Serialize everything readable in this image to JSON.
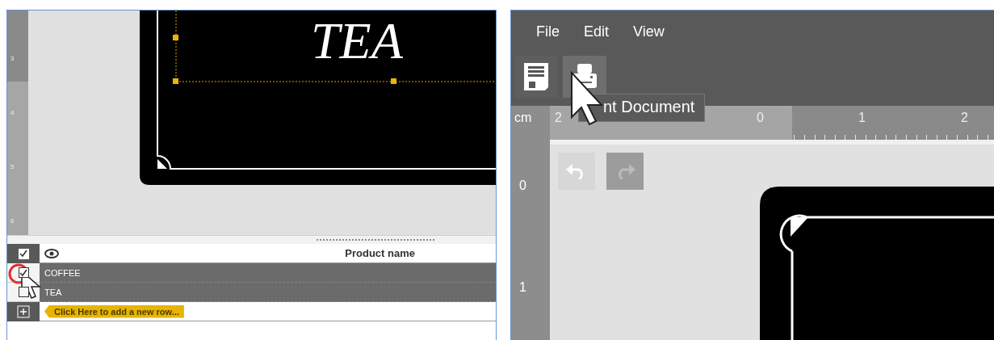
{
  "label_editor": {
    "vertical_ruler": [
      "3",
      "4",
      "5",
      "6"
    ],
    "label_text": "TEA",
    "table": {
      "header_checked": true,
      "column_heading": "Product name",
      "rows": [
        {
          "name": "COFFEE",
          "checked": true
        },
        {
          "name": "TEA",
          "checked": false
        }
      ],
      "add_row_hint": "Click Here to add a new row..."
    }
  },
  "designer": {
    "menu": [
      "File",
      "Edit",
      "View"
    ],
    "tooltip": "nt Document",
    "ruler_unit": "cm",
    "horizontal_ruler": [
      "2",
      "0",
      "1",
      "2"
    ],
    "vertical_ruler": [
      "0",
      "1"
    ],
    "undo": {
      "disabled": true
    },
    "redo": {
      "disabled": false
    }
  }
}
